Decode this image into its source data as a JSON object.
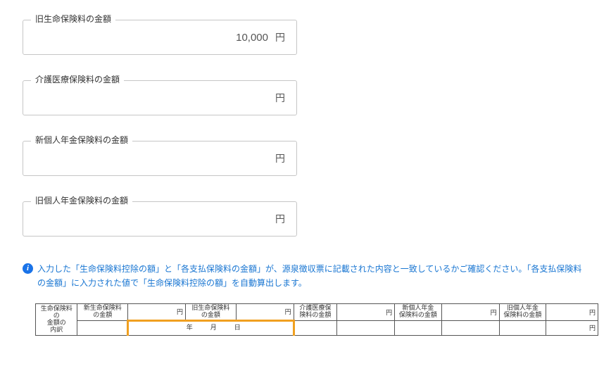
{
  "fields": {
    "old_life": {
      "label": "旧生命保険料の金額",
      "value": "10,000",
      "unit": "円"
    },
    "care_medical": {
      "label": "介護医療保険料の金額",
      "value": "",
      "unit": "円"
    },
    "new_pension": {
      "label": "新個人年金保険料の金額",
      "value": "",
      "unit": "円"
    },
    "old_pension": {
      "label": "旧個人年金保険料の金額",
      "value": "",
      "unit": "円"
    }
  },
  "info": "入力した「生命保険料控除の額」と「各支払保険料の金額」が、源泉徴収票に記載された内容と一致しているかご確認ください。「各支払保険料の金額」に入力された値で「生命保険料控除の額」を自動算出します。",
  "table": {
    "row1": {
      "c1a": "生命保険料の",
      "c1b": "金額の",
      "c1c": "内訳",
      "c2a": "新生命保険料",
      "c2b": "の金額",
      "c3_unit": "円",
      "c4a": "旧生命保険料",
      "c4b": "の金額",
      "c5_unit": "円",
      "c6a": "介護医療保",
      "c6b": "険料の金額",
      "c7_unit": "円",
      "c8a": "新個人年金",
      "c8b": "保険料の金額",
      "c9_unit": "円",
      "c10a": "旧個人年金",
      "c10b": "保険料の金額",
      "c11_unit": "円"
    },
    "row2": {
      "c_year": "年",
      "c_month": "月",
      "c_day": "日",
      "c_right_unit": "円"
    }
  }
}
